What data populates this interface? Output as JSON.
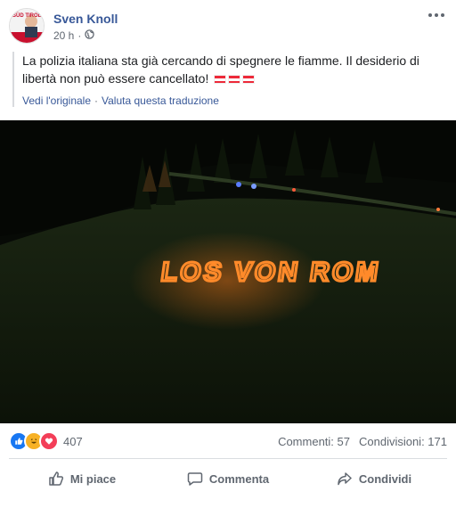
{
  "post": {
    "author": "Sven Knoll",
    "time": "20 h",
    "privacy_icon": "globe-icon",
    "text": "La polizia italiana sta già cercando di spegnere le fiamme. Il desiderio di libertà non può essere cancellato!",
    "flags": "austria-flag-emoji",
    "see_original": "Vedi l'originale",
    "separator": "·",
    "rate_translation": "Valuta questa traduzione",
    "avatar_text": "SÜD TIROL"
  },
  "photo": {
    "fire_text": "LOS VON ROM"
  },
  "stats": {
    "reactions_count": "407",
    "comments": "Commenti: 57",
    "shares": "Condivisioni: 171"
  },
  "actions": {
    "like": "Mi piace",
    "comment": "Commenta",
    "share": "Condividi"
  },
  "colors": {
    "link": "#385898",
    "secondary": "#606770",
    "fire": "#ff7a1a"
  }
}
